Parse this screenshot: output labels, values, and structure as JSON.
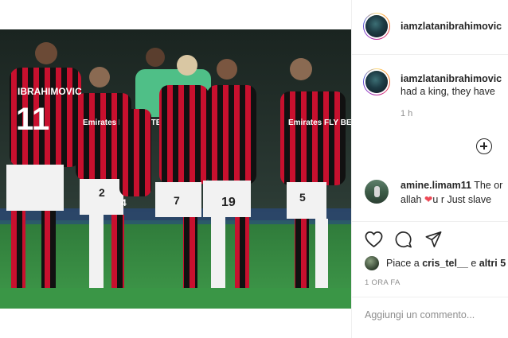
{
  "post": {
    "author_username": "iamzlatanibrahimovic",
    "caption_text": "had a king, they have",
    "caption_age": "1 h",
    "jerseys": [
      {
        "name": "IBRAHIMOVIC",
        "number": "11"
      },
      {
        "name": "",
        "number": "2"
      },
      {
        "name": "",
        "number": "4"
      },
      {
        "name": "",
        "number": "7"
      },
      {
        "name": "",
        "number": "19"
      },
      {
        "name": "",
        "number": "5"
      }
    ],
    "sponsor": "Emirates FLY BETTER"
  },
  "comment": {
    "username": "amine.limam11",
    "text_line1": "The or",
    "text_line2_before": "allah",
    "text_line2_after": "u r Just slave"
  },
  "actions": {
    "like_icon": "heart-outline-icon",
    "comment_icon": "speech-bubble-icon",
    "share_icon": "paper-plane-icon"
  },
  "likes": {
    "prefix": "Piace a",
    "user": "cris_tel__",
    "connector": "e",
    "others": "altri 5"
  },
  "timestamp": "1 ORA FA",
  "add_comment": {
    "placeholder": "Aggiungi un commento..."
  },
  "colors": {
    "milan_red": "#c8102e",
    "milan_black": "#111111",
    "heart_red": "#ed4956"
  }
}
